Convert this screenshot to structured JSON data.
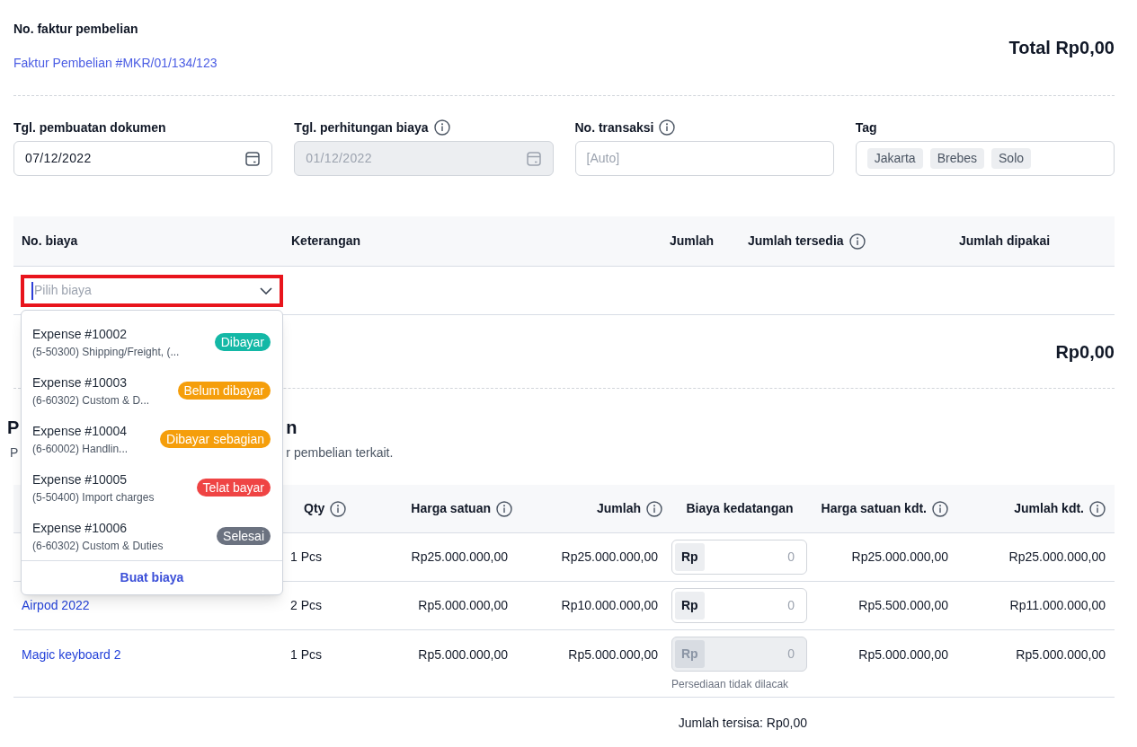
{
  "invoice": {
    "label": "No. faktur pembelian",
    "link": "Faktur Pembelian #MKR/01/134/123",
    "total": "Total Rp0,00"
  },
  "fields": [
    {
      "kind": "date",
      "label": "Tgl. pembuatan dokumen",
      "value": "07/12/2022",
      "disabled": false
    },
    {
      "kind": "date",
      "label": "Tgl. perhitungan biaya",
      "info": true,
      "value": "01/12/2022",
      "disabled": true
    },
    {
      "kind": "text",
      "label": "No. transaksi",
      "info": true,
      "placeholder": "[Auto]",
      "disabled": false
    },
    {
      "kind": "tags",
      "label": "Tag",
      "tags": [
        "Jakarta",
        "Brebes",
        "Solo"
      ],
      "disabled": false
    }
  ],
  "cost_table": {
    "columns": [
      {
        "label": "No. biaya"
      },
      {
        "label": "Keterangan"
      },
      {
        "label": "Jumlah"
      },
      {
        "label": "Jumlah tersedia",
        "info": true
      },
      {
        "label": "Jumlah dipakai"
      }
    ],
    "select": {
      "placeholder": "Pilih biaya",
      "highlighted": true,
      "expanded": true
    },
    "total": "Rp0,00"
  },
  "dropdown": {
    "options": [
      {
        "title": "Expense #10002",
        "subtitle": "(5-50300) Shipping/Freight, (...",
        "status": "Dibayar",
        "color": "#14b8a6"
      },
      {
        "title": "Expense #10003",
        "subtitle": "(6-60302) Custom & D...",
        "status": "Belum dibayar",
        "color": "#f59e0b"
      },
      {
        "title": "Expense #10004",
        "subtitle": "(6-60002) Handlin...",
        "status": "Dibayar sebagian",
        "color": "#f59e0b"
      },
      {
        "title": "Expense #10005",
        "subtitle": "(5-50400) Import charges",
        "status": "Telat bayar",
        "color": "#ef4444"
      },
      {
        "title": "Expense #10006",
        "subtitle": "(6-60302) Custom & Duties",
        "status": "Selesai",
        "color": "#6b7280"
      }
    ],
    "footer": "Buat biaya"
  },
  "section": {
    "heading_start": "P",
    "heading_end": "n",
    "subtitle_start": "P",
    "subtitle_end": "r pembelian terkait."
  },
  "items_table": {
    "columns": [
      {
        "label": "Qty",
        "info": true
      },
      {
        "label": "Harga satuan",
        "info": true
      },
      {
        "label": "Jumlah",
        "info": true
      },
      {
        "label": "Biaya kedatangan"
      },
      {
        "label": "Harga satuan kdt.",
        "info": true
      },
      {
        "label": "Jumlah kdt.",
        "info": true
      }
    ],
    "rows": [
      {
        "qty": "1 Pcs",
        "price": "Rp25.000.000,00",
        "amount": "Rp25.000.000,00",
        "cost_prefix": "Rp",
        "cost_value": "0",
        "disabled": false,
        "landed_price": "Rp25.000.000,00",
        "landed_amount": "Rp25.000.000,00"
      },
      {
        "product": "Airpod 2022",
        "qty": "2 Pcs",
        "price": "Rp5.000.000,00",
        "amount": "Rp10.000.000,00",
        "cost_prefix": "Rp",
        "cost_value": "0",
        "disabled": false,
        "landed_price": "Rp5.500.000,00",
        "landed_amount": "Rp11.000.000,00"
      },
      {
        "product": "Magic keyboard 2",
        "qty": "1 Pcs",
        "price": "Rp5.000.000,00",
        "amount": "Rp5.000.000,00",
        "cost_prefix": "Rp",
        "cost_value": "0",
        "disabled": true,
        "note": "Persediaan tidak dilacak",
        "landed_price": "Rp5.000.000,00",
        "landed_amount": "Rp5.000.000,00"
      }
    ],
    "remaining": "Jumlah tersisa: Rp0,00"
  }
}
